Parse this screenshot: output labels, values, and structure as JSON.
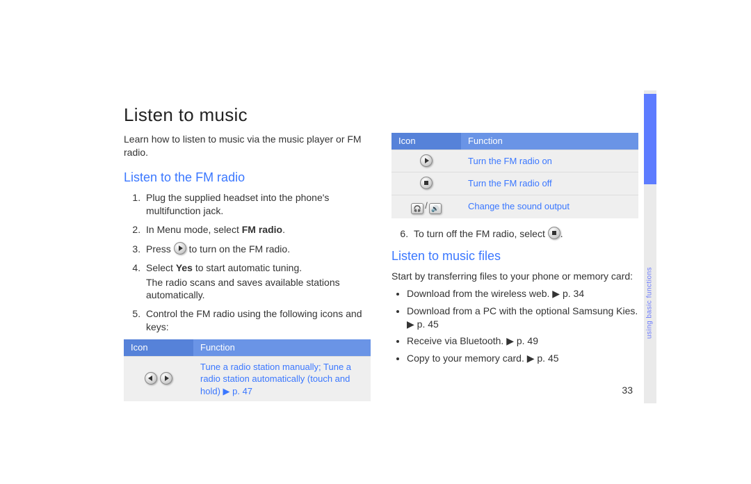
{
  "title": "Listen to music",
  "intro": "Learn how to listen to music via the music player or FM radio.",
  "section_fm": "Listen to the FM radio",
  "section_files": "Listen to music files",
  "steps": {
    "s1": "Plug the supplied headset into the phone's multifunction jack.",
    "s2a": "In Menu mode, select ",
    "s2b": "FM radio",
    "s2c": ".",
    "s3a": "Press ",
    "s3b": " to turn on the FM radio.",
    "s4a": "Select ",
    "s4b": "Yes",
    "s4c": " to start automatic tuning.",
    "s4sub": "The radio scans and saves available stations automatically.",
    "s5": "Control the FM radio using the following icons and keys:",
    "s6a": "To turn off the FM radio, select ",
    "s6b": "."
  },
  "table1": {
    "h_icon": "Icon",
    "h_func": "Function",
    "r1": "Tune a radio station manually; Tune a radio station automatically (touch and hold) ▶ p. 47"
  },
  "table2": {
    "h_icon": "Icon",
    "h_func": "Function",
    "r1": "Turn the FM radio on",
    "r2": "Turn the FM radio off",
    "r3": "Change the sound output"
  },
  "files_intro": "Start by transferring files to your phone or memory card:",
  "files_bullets": {
    "b1": "Download from the wireless web. ▶ p. 34",
    "b2": "Download from a PC with the optional Samsung Kies. ▶ p. 45",
    "b3": "Receive via Bluetooth. ▶ p. 49",
    "b4": "Copy to your memory card. ▶ p. 45"
  },
  "sidebar_label": "using basic functions",
  "page_number": "33"
}
